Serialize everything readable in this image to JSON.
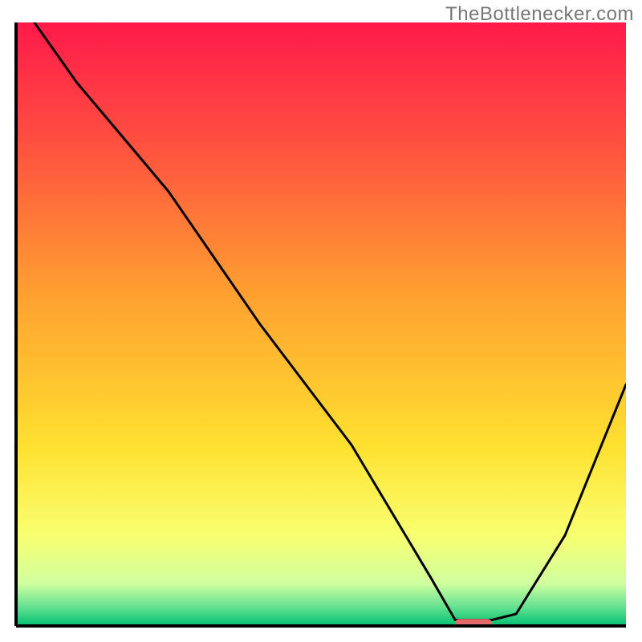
{
  "watermark": "TheBottlenecker.com",
  "chart_data": {
    "type": "line",
    "title": "",
    "xlabel": "",
    "ylabel": "",
    "xlim": [
      0,
      100
    ],
    "ylim": [
      0,
      100
    ],
    "background": {
      "type": "vertical-gradient",
      "stops": [
        {
          "offset": 0.0,
          "color": "#ff1a4a"
        },
        {
          "offset": 0.2,
          "color": "#ff5040"
        },
        {
          "offset": 0.45,
          "color": "#ffa030"
        },
        {
          "offset": 0.7,
          "color": "#ffe030"
        },
        {
          "offset": 0.85,
          "color": "#f8ff70"
        },
        {
          "offset": 0.93,
          "color": "#d0ffa0"
        },
        {
          "offset": 0.97,
          "color": "#60e090"
        },
        {
          "offset": 1.0,
          "color": "#00c070"
        }
      ]
    },
    "series": [
      {
        "name": "bottleneck-curve",
        "color": "#000000",
        "width": 3,
        "x": [
          3,
          10,
          20,
          25,
          40,
          55,
          68,
          72,
          78,
          82,
          90,
          100
        ],
        "y": [
          100,
          90,
          78,
          72,
          50,
          30,
          8,
          1,
          1,
          2,
          15,
          40
        ]
      }
    ],
    "marker": {
      "name": "optimal-range",
      "color": "#e26a6a",
      "x_start": 72,
      "x_end": 78,
      "y": 0.5,
      "thickness": 10
    },
    "axes": {
      "color": "#000000",
      "width": 4
    }
  }
}
